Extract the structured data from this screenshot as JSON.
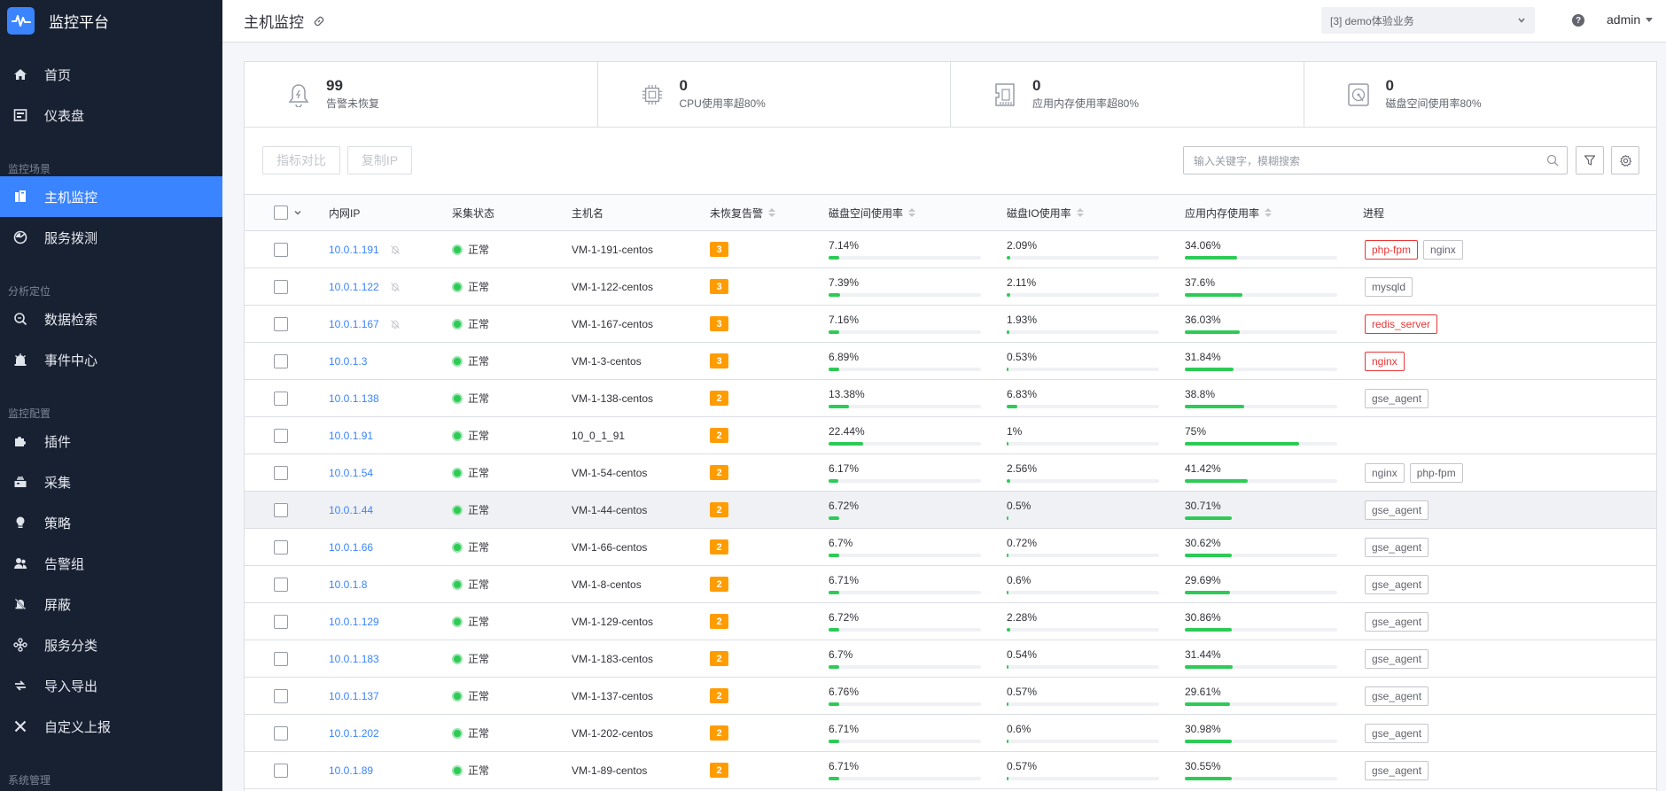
{
  "brand": {
    "name": "监控平台"
  },
  "nav": {
    "top": [
      {
        "label": "首页",
        "icon": "home-icon"
      },
      {
        "label": "仪表盘",
        "icon": "dashboard-icon"
      }
    ],
    "groups": [
      {
        "title": "监控场景",
        "items": [
          {
            "label": "主机监控",
            "icon": "host-icon",
            "active": true
          },
          {
            "label": "服务拨测",
            "icon": "uptime-check-icon"
          }
        ]
      },
      {
        "title": "分析定位",
        "items": [
          {
            "label": "数据检索",
            "icon": "data-search-icon"
          },
          {
            "label": "事件中心",
            "icon": "event-center-icon"
          }
        ]
      },
      {
        "title": "监控配置",
        "items": [
          {
            "label": "插件",
            "icon": "plugin-icon"
          },
          {
            "label": "采集",
            "icon": "collect-icon"
          },
          {
            "label": "策略",
            "icon": "strategy-icon"
          },
          {
            "label": "告警组",
            "icon": "alarm-group-icon"
          },
          {
            "label": "屏蔽",
            "icon": "shield-icon"
          },
          {
            "label": "服务分类",
            "icon": "service-category-icon"
          },
          {
            "label": "导入导出",
            "icon": "import-export-icon"
          },
          {
            "label": "自定义上报",
            "icon": "custom-report-icon"
          }
        ]
      },
      {
        "title": "系统管理",
        "items": []
      }
    ]
  },
  "header": {
    "title": "主机监控",
    "business": "[3] demo体验业务",
    "help": "?",
    "user": "admin"
  },
  "stats": [
    {
      "value": "99",
      "label": "告警未恢复",
      "icon": "alarm-bell-icon"
    },
    {
      "value": "0",
      "label": "CPU使用率超80%",
      "icon": "cpu-icon"
    },
    {
      "value": "0",
      "label": "应用内存使用率超80%",
      "icon": "memory-icon"
    },
    {
      "value": "0",
      "label": "磁盘空间使用率80%",
      "icon": "disk-icon"
    }
  ],
  "toolbar": {
    "compare_label": "指标对比",
    "copy_ip_label": "复制IP",
    "search_placeholder": "输入关键字，模糊搜索"
  },
  "table": {
    "columns": {
      "ip": "内网IP",
      "status": "采集状态",
      "hostname": "主机名",
      "alarms": "未恢复告警",
      "disk": "磁盘空间使用率",
      "io": "磁盘IO使用率",
      "mem": "应用内存使用率",
      "process": "进程"
    },
    "rows": [
      {
        "ip": "10.0.1.191",
        "muted": true,
        "status": "正常",
        "host": "VM-1-191-centos",
        "alarms": "3",
        "disk": "7.14%",
        "disk_v": 7.14,
        "io": "2.09%",
        "io_v": 2.09,
        "mem": "34.06%",
        "mem_v": 34.06,
        "procs": [
          {
            "name": "php-fpm",
            "alert": true
          },
          {
            "name": "nginx",
            "alert": false
          }
        ]
      },
      {
        "ip": "10.0.1.122",
        "muted": true,
        "status": "正常",
        "host": "VM-1-122-centos",
        "alarms": "3",
        "disk": "7.39%",
        "disk_v": 7.39,
        "io": "2.11%",
        "io_v": 2.11,
        "mem": "37.6%",
        "mem_v": 37.6,
        "procs": [
          {
            "name": "mysqld",
            "alert": false
          }
        ]
      },
      {
        "ip": "10.0.1.167",
        "muted": true,
        "status": "正常",
        "host": "VM-1-167-centos",
        "alarms": "3",
        "disk": "7.16%",
        "disk_v": 7.16,
        "io": "1.93%",
        "io_v": 1.93,
        "mem": "36.03%",
        "mem_v": 36.03,
        "procs": [
          {
            "name": "redis_server",
            "alert": true
          }
        ]
      },
      {
        "ip": "10.0.1.3",
        "muted": false,
        "status": "正常",
        "host": "VM-1-3-centos",
        "alarms": "3",
        "disk": "6.89%",
        "disk_v": 6.89,
        "io": "0.53%",
        "io_v": 0.53,
        "mem": "31.84%",
        "mem_v": 31.84,
        "procs": [
          {
            "name": "nginx",
            "alert": true
          }
        ]
      },
      {
        "ip": "10.0.1.138",
        "muted": false,
        "status": "正常",
        "host": "VM-1-138-centos",
        "alarms": "2",
        "disk": "13.38%",
        "disk_v": 13.38,
        "io": "6.83%",
        "io_v": 6.83,
        "mem": "38.8%",
        "mem_v": 38.8,
        "procs": [
          {
            "name": "gse_agent",
            "alert": false
          }
        ]
      },
      {
        "ip": "10.0.1.91",
        "muted": false,
        "status": "正常",
        "host": "10_0_1_91",
        "alarms": "2",
        "disk": "22.44%",
        "disk_v": 22.44,
        "io": "1%",
        "io_v": 1,
        "mem": "75%",
        "mem_v": 75,
        "procs": []
      },
      {
        "ip": "10.0.1.54",
        "muted": false,
        "status": "正常",
        "host": "VM-1-54-centos",
        "alarms": "2",
        "disk": "6.17%",
        "disk_v": 6.17,
        "io": "2.56%",
        "io_v": 2.56,
        "mem": "41.42%",
        "mem_v": 41.42,
        "procs": [
          {
            "name": "nginx",
            "alert": false
          },
          {
            "name": "php-fpm",
            "alert": false
          }
        ]
      },
      {
        "ip": "10.0.1.44",
        "muted": false,
        "hover": true,
        "status": "正常",
        "host": "VM-1-44-centos",
        "alarms": "2",
        "disk": "6.72%",
        "disk_v": 6.72,
        "io": "0.5%",
        "io_v": 0.5,
        "mem": "30.71%",
        "mem_v": 30.71,
        "procs": [
          {
            "name": "gse_agent",
            "alert": false
          }
        ]
      },
      {
        "ip": "10.0.1.66",
        "muted": false,
        "status": "正常",
        "host": "VM-1-66-centos",
        "alarms": "2",
        "disk": "6.7%",
        "disk_v": 6.7,
        "io": "0.72%",
        "io_v": 0.72,
        "mem": "30.62%",
        "mem_v": 30.62,
        "procs": [
          {
            "name": "gse_agent",
            "alert": false
          }
        ]
      },
      {
        "ip": "10.0.1.8",
        "muted": false,
        "status": "正常",
        "host": "VM-1-8-centos",
        "alarms": "2",
        "disk": "6.71%",
        "disk_v": 6.71,
        "io": "0.6%",
        "io_v": 0.6,
        "mem": "29.69%",
        "mem_v": 29.69,
        "procs": [
          {
            "name": "gse_agent",
            "alert": false
          }
        ]
      },
      {
        "ip": "10.0.1.129",
        "muted": false,
        "status": "正常",
        "host": "VM-1-129-centos",
        "alarms": "2",
        "disk": "6.72%",
        "disk_v": 6.72,
        "io": "2.28%",
        "io_v": 2.28,
        "mem": "30.86%",
        "mem_v": 30.86,
        "procs": [
          {
            "name": "gse_agent",
            "alert": false
          }
        ]
      },
      {
        "ip": "10.0.1.183",
        "muted": false,
        "status": "正常",
        "host": "VM-1-183-centos",
        "alarms": "2",
        "disk": "6.7%",
        "disk_v": 6.7,
        "io": "0.54%",
        "io_v": 0.54,
        "mem": "31.44%",
        "mem_v": 31.44,
        "procs": [
          {
            "name": "gse_agent",
            "alert": false
          }
        ]
      },
      {
        "ip": "10.0.1.137",
        "muted": false,
        "status": "正常",
        "host": "VM-1-137-centos",
        "alarms": "2",
        "disk": "6.76%",
        "disk_v": 6.76,
        "io": "0.57%",
        "io_v": 0.57,
        "mem": "29.61%",
        "mem_v": 29.61,
        "procs": [
          {
            "name": "gse_agent",
            "alert": false
          }
        ]
      },
      {
        "ip": "10.0.1.202",
        "muted": false,
        "status": "正常",
        "host": "VM-1-202-centos",
        "alarms": "2",
        "disk": "6.71%",
        "disk_v": 6.71,
        "io": "0.6%",
        "io_v": 0.6,
        "mem": "30.98%",
        "mem_v": 30.98,
        "procs": [
          {
            "name": "gse_agent",
            "alert": false
          }
        ]
      },
      {
        "ip": "10.0.1.89",
        "muted": false,
        "status": "正常",
        "host": "VM-1-89-centos",
        "alarms": "2",
        "disk": "6.71%",
        "disk_v": 6.71,
        "io": "0.57%",
        "io_v": 0.57,
        "mem": "30.55%",
        "mem_v": 30.55,
        "procs": [
          {
            "name": "gse_agent",
            "alert": false
          }
        ]
      }
    ]
  },
  "colors": {
    "accent": "#3a84ff",
    "sidebar_bg": "#182132",
    "ok": "#2dcb56",
    "badge": "#ff9c01",
    "alert": "#ea3636"
  }
}
